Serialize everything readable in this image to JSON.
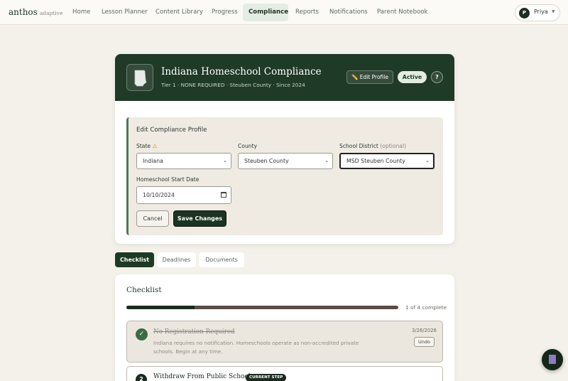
{
  "nav": {
    "brand": "anthos",
    "brand_sub": "adaptive",
    "links": [
      "Home",
      "Lesson Planner",
      "Content Library",
      "Progress",
      "Compliance",
      "Reports",
      "Notifications",
      "Parent Notebook"
    ],
    "active": "Compliance",
    "user": {
      "initial": "P",
      "name": "Priya"
    }
  },
  "profile": {
    "title": "Indiana Homeschool Compliance",
    "subtitle": "Tier 1 · NONE REQUIRED · Steuben County · Since 2024",
    "edit_label": "✏️ Edit Profile",
    "status": "Active",
    "help": "?"
  },
  "edit_form": {
    "title": "Edit Compliance Profile",
    "state_label": "State",
    "state_warning": "⚠",
    "state_value": "Indiana",
    "county_label": "County",
    "county_value": "Steuben County",
    "district_label": "School District",
    "district_optional": "(optional)",
    "district_value": "MSD Steuben County",
    "start_label": "Homeschool Start Date",
    "start_value": "10/10/2024",
    "cancel": "Cancel",
    "save": "Save Changes"
  },
  "tabs": [
    "Checklist",
    "Deadlines",
    "Documents"
  ],
  "checklist": {
    "title": "Checklist",
    "completed": 1,
    "total": 4,
    "progress_text": "1 of 4 complete",
    "items": [
      {
        "title": "No Registration Required",
        "description": "Indiana requires no notification. Homeschools operate as non-accredited private schools. Begin at any time.",
        "date": "3/26/2026",
        "action": "Undo",
        "status_icon": "✓"
      },
      {
        "number": "2",
        "title": "Withdraw From Public School",
        "badge": "CURRENT STEP"
      }
    ]
  },
  "colors": {
    "primary": "#1f3a27",
    "accent": "#4c7a55",
    "background": "#f4f1eb"
  }
}
